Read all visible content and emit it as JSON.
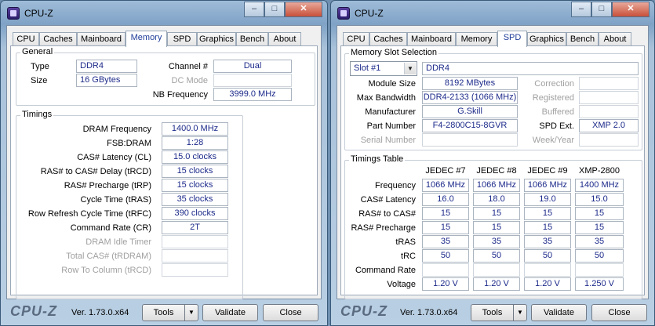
{
  "left": {
    "title": "CPU-Z",
    "tabs": [
      "CPU",
      "Caches",
      "Mainboard",
      "Memory",
      "SPD",
      "Graphics",
      "Bench",
      "About"
    ],
    "active_tab": "Memory",
    "general": {
      "title": "General",
      "type_label": "Type",
      "type_value": "DDR4",
      "size_label": "Size",
      "size_value": "16 GBytes",
      "channel_label": "Channel #",
      "channel_value": "Dual",
      "dcmode_label": "DC Mode",
      "dcmode_value": "",
      "nbfreq_label": "NB Frequency",
      "nbfreq_value": "3999.0 MHz"
    },
    "timings": {
      "title": "Timings",
      "rows": [
        {
          "label": "DRAM Frequency",
          "value": "1400.0 MHz",
          "enabled": true
        },
        {
          "label": "FSB:DRAM",
          "value": "1:28",
          "enabled": true
        },
        {
          "label": "CAS# Latency (CL)",
          "value": "15.0 clocks",
          "enabled": true
        },
        {
          "label": "RAS# to CAS# Delay (tRCD)",
          "value": "15 clocks",
          "enabled": true
        },
        {
          "label": "RAS# Precharge (tRP)",
          "value": "15 clocks",
          "enabled": true
        },
        {
          "label": "Cycle Time (tRAS)",
          "value": "35 clocks",
          "enabled": true
        },
        {
          "label": "Row Refresh Cycle Time (tRFC)",
          "value": "390 clocks",
          "enabled": true
        },
        {
          "label": "Command Rate (CR)",
          "value": "2T",
          "enabled": true
        },
        {
          "label": "DRAM Idle Timer",
          "value": "",
          "enabled": false
        },
        {
          "label": "Total CAS# (tRDRAM)",
          "value": "",
          "enabled": false
        },
        {
          "label": "Row To Column (tRCD)",
          "value": "",
          "enabled": false
        }
      ]
    },
    "footer": {
      "logo": "CPU-Z",
      "version": "Ver. 1.73.0.x64",
      "tools": "Tools",
      "validate": "Validate",
      "close": "Close"
    }
  },
  "right": {
    "title": "CPU-Z",
    "tabs": [
      "CPU",
      "Caches",
      "Mainboard",
      "Memory",
      "SPD",
      "Graphics",
      "Bench",
      "About"
    ],
    "active_tab": "SPD",
    "slot": {
      "title": "Memory Slot Selection",
      "selected": "Slot #1",
      "type_value": "DDR4",
      "module_size_label": "Module Size",
      "module_size_value": "8192 MBytes",
      "max_bw_label": "Max Bandwidth",
      "max_bw_value": "DDR4-2133 (1066 MHz)",
      "manufacturer_label": "Manufacturer",
      "manufacturer_value": "G.Skill",
      "part_label": "Part Number",
      "part_value": "F4-2800C15-8GVR",
      "serial_label": "Serial Number",
      "serial_value": "",
      "correction_label": "Correction",
      "correction_value": "",
      "registered_label": "Registered",
      "registered_value": "",
      "buffered_label": "Buffered",
      "buffered_value": "",
      "spdext_label": "SPD Ext.",
      "spdext_value": "XMP 2.0",
      "weekyear_label": "Week/Year",
      "weekyear_value": ""
    },
    "timings_table": {
      "title": "Timings Table",
      "columns": [
        "JEDEC #7",
        "JEDEC #8",
        "JEDEC #9",
        "XMP-2800"
      ],
      "rows": [
        {
          "label": "Frequency",
          "values": [
            "1066 MHz",
            "1066 MHz",
            "1066 MHz",
            "1400 MHz"
          ]
        },
        {
          "label": "CAS# Latency",
          "values": [
            "16.0",
            "18.0",
            "19.0",
            "15.0"
          ]
        },
        {
          "label": "RAS# to CAS#",
          "values": [
            "15",
            "15",
            "15",
            "15"
          ]
        },
        {
          "label": "RAS# Precharge",
          "values": [
            "15",
            "15",
            "15",
            "15"
          ]
        },
        {
          "label": "tRAS",
          "values": [
            "35",
            "35",
            "35",
            "35"
          ]
        },
        {
          "label": "tRC",
          "values": [
            "50",
            "50",
            "50",
            "50"
          ]
        },
        {
          "label": "Command Rate",
          "values": [
            "",
            "",
            "",
            ""
          ]
        },
        {
          "label": "Voltage",
          "values": [
            "1.20 V",
            "1.20 V",
            "1.20 V",
            "1.250 V"
          ]
        }
      ]
    },
    "footer": {
      "logo": "CPU-Z",
      "version": "Ver. 1.73.0.x64",
      "tools": "Tools",
      "validate": "Validate",
      "close": "Close"
    }
  }
}
